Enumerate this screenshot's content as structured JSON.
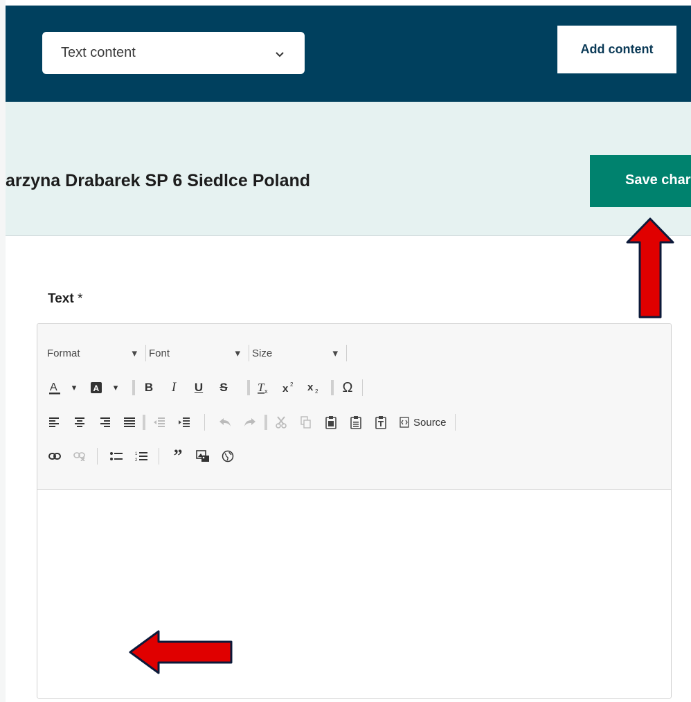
{
  "header": {
    "content_type_select": {
      "value": "Text content"
    },
    "add_content_label": "Add content"
  },
  "title_band": {
    "doc_title": "arzyna Drabarek SP 6 Siedlce Poland",
    "save_label": "Save char"
  },
  "field": {
    "label": "Text",
    "required_mark": "*"
  },
  "toolbar": {
    "format_label": "Format",
    "font_label": "Font",
    "size_label": "Size",
    "source_label": "Source",
    "row2_icons": [
      "text-color-icon",
      "background-color-icon",
      "bold-icon",
      "italic-icon",
      "underline-icon",
      "strikethrough-icon",
      "remove-format-icon",
      "superscript-icon",
      "subscript-icon",
      "special-character-icon"
    ],
    "row3_icons": [
      "align-left-icon",
      "align-center-icon",
      "align-right-icon",
      "justify-icon",
      "decrease-indent-icon",
      "increase-indent-icon",
      "undo-icon",
      "redo-icon",
      "cut-icon",
      "copy-icon",
      "paste-icon",
      "paste-text-icon",
      "paste-from-word-icon",
      "source-icon"
    ],
    "row4_icons": [
      "link-icon",
      "unlink-icon",
      "bulleted-list-icon",
      "numbered-list-icon",
      "blockquote-icon",
      "image-icon",
      "iframe-globe-icon"
    ]
  },
  "colors": {
    "header_bg": "#00405e",
    "band_bg": "#e6f2f1",
    "save_bg": "#00826e",
    "annotation_arrow": "#e00000"
  }
}
